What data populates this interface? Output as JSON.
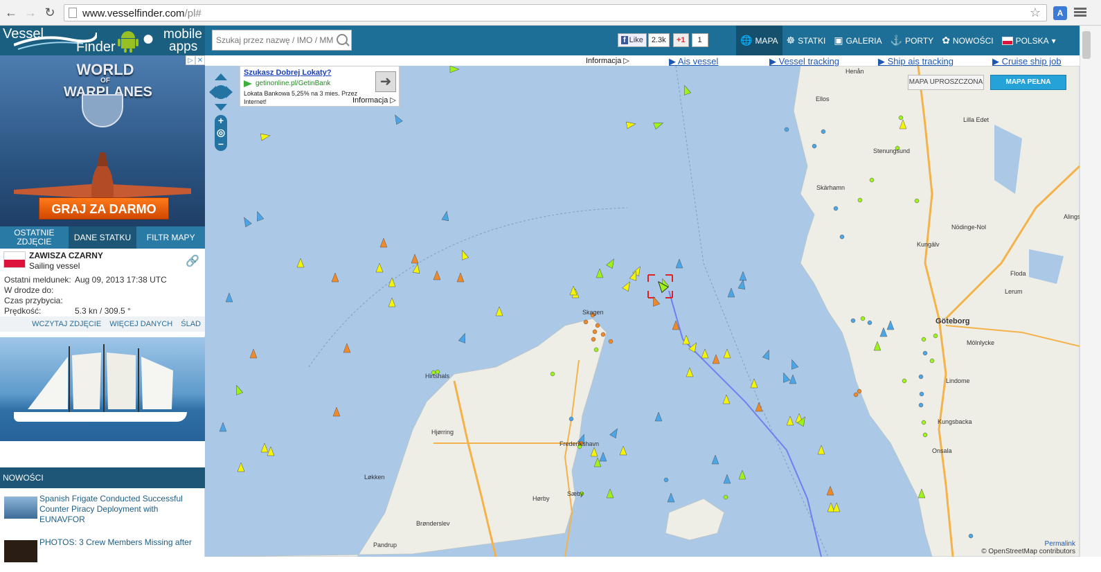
{
  "browser": {
    "url_host": "www.vesselfinder.com",
    "url_path": "/pl#",
    "extension_label": "A"
  },
  "logo": {
    "line1": "Vessel",
    "line2": "Finder",
    "mobile1": "mobile",
    "mobile2": "apps"
  },
  "ad_banner": {
    "title1": "WORLD",
    "title_of": "OF",
    "title2": "WARPLANES",
    "cta": "GRAJ ZA DARMO"
  },
  "sidebar_tabs": [
    "OSTATNIE ZDJĘCIE",
    "DANE STATKU",
    "FILTR MAPY"
  ],
  "vessel": {
    "name": "ZAWISZA CZARNY",
    "type": "Sailing vessel",
    "rows": [
      {
        "k": "Ostatni meldunek:",
        "v": "Aug 09, 2013 17:38 UTC"
      },
      {
        "k": "W drodze do:",
        "v": ""
      },
      {
        "k": "Czas przybycia:",
        "v": ""
      },
      {
        "k": "Prędkość:",
        "v": "5.3 kn / 309.5 °"
      }
    ],
    "actions": [
      "WCZYTAJ ZDJĘCIE",
      "WIĘCEJ DANYCH",
      "ŚLAD"
    ]
  },
  "news": {
    "heading": "NOWOŚCI",
    "items": [
      "Spanish Frigate Conducted Successful Counter Piracy Deployment with EUNAVFOR",
      "PHOTOS: 3 Crew Members Missing after"
    ]
  },
  "search": {
    "placeholder": "Szukaj przez nazwę / IMO / MMSI"
  },
  "social": {
    "fb_like": "Like",
    "fb_count": "2.3k",
    "gplus": "+1",
    "gplus_count": "1"
  },
  "nav": [
    "MAPA",
    "STATKI",
    "GALERIA",
    "PORTY",
    "NOWOŚCI",
    "POLSKA"
  ],
  "map": {
    "info_label": "Informacja",
    "top_links": [
      "Ais vessel",
      "Vessel tracking",
      "Ship ais tracking",
      "Cruise ship job"
    ],
    "ad": {
      "title": "Szukasz Dobrej Lokaty?",
      "url": "getinonline.pl/GetinBank",
      "text": "Lokata Bankowa 5,25% na 3 mies. Przez Internet!",
      "info": "Informacja"
    },
    "btn_simple": "MAPA UPROSZCZONA",
    "btn_full": "MAPA PEŁNA",
    "attribution": "© OpenStreetMap contributors",
    "permalink": "Permalink",
    "places": [
      "Henån",
      "Ellos",
      "Lilla Edet",
      "Stenungsund",
      "Skärhamn",
      "Kungälv",
      "Nödinge-Nol",
      "Floda",
      "Lerum",
      "Alings",
      "Göteborg",
      "Mölnlycke",
      "Lindome",
      "Kungsbacka",
      "Onsala",
      "Skagen",
      "Hirtshals",
      "Hjørring",
      "Frederikshavn",
      "Løkken",
      "Hørby",
      "Sæby",
      "Brønderslev",
      "Pandrup"
    ]
  },
  "colors": {
    "brand": "#1e6f98",
    "sea": "#abc8e6",
    "land": "#efeee6",
    "track": "#6f7ff0",
    "cargo": "#9cf21a",
    "tanker": "#f4f409",
    "passenger": "#4aa6e6",
    "fishing": "#f08a28",
    "selected": "#e02020"
  }
}
